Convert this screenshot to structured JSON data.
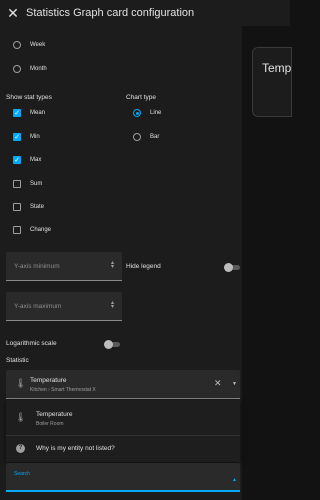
{
  "header": {
    "title": "Statistics Graph card configuration"
  },
  "preview": {
    "text": "Temp"
  },
  "period": {
    "options": [
      {
        "label": "Week",
        "checked": false
      },
      {
        "label": "Month",
        "checked": false
      }
    ]
  },
  "stat_types": {
    "title": "Show stat types",
    "items": [
      {
        "label": "Mean",
        "checked": true
      },
      {
        "label": "Min",
        "checked": true
      },
      {
        "label": "Max",
        "checked": true
      },
      {
        "label": "Sum",
        "checked": false
      },
      {
        "label": "State",
        "checked": false
      },
      {
        "label": "Change",
        "checked": false
      }
    ]
  },
  "chart_type": {
    "title": "Chart type",
    "options": [
      {
        "label": "Line",
        "checked": true
      },
      {
        "label": "Bar",
        "checked": false
      }
    ]
  },
  "y_min": {
    "label": "Y-axis minimum"
  },
  "hide_legend": {
    "label": "Hide legend",
    "on": false
  },
  "y_max": {
    "label": "Y-axis maximum"
  },
  "log_scale": {
    "label": "Logarithmic scale",
    "on": false
  },
  "statistic": {
    "title": "Statistic",
    "selected": {
      "name": "Temperature",
      "sub": "Kitchen › Smart Thermostat X"
    },
    "options": [
      {
        "name": "Temperature",
        "sub": "Boiler Room"
      }
    ],
    "help": "Why is my entity not listed?",
    "search_label": "Search"
  },
  "icons": {
    "close": "close-icon",
    "thermometer": "thermometer-icon",
    "help": "help-circle-icon"
  },
  "colors": {
    "accent": "#03a9f4",
    "background": "#1c1c1c"
  }
}
